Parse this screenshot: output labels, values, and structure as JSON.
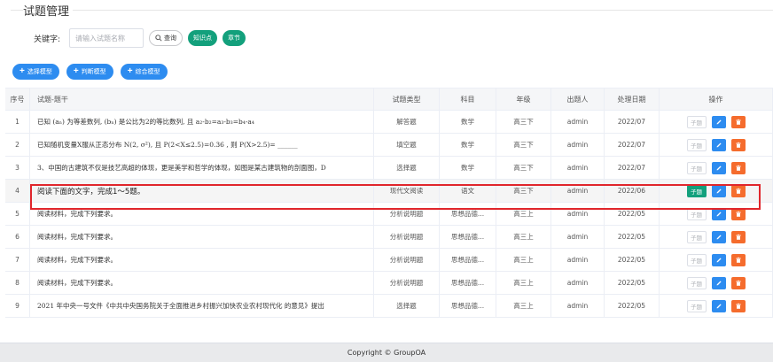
{
  "page": {
    "title": "试题管理"
  },
  "search": {
    "label": "关键字:",
    "placeholder": "请输入试题名称",
    "query_label": "查询",
    "knowledge_label": "知识点",
    "chapter_label": "章节"
  },
  "toolbar": {
    "buttons": [
      {
        "label": "选择模型"
      },
      {
        "label": "判断模型"
      },
      {
        "label": "综合模型"
      }
    ]
  },
  "table": {
    "columns": [
      "序号",
      "试题-题干",
      "试题类型",
      "科目",
      "年级",
      "出题人",
      "处理日期",
      "操作"
    ],
    "rows": [
      {
        "no": "1",
        "stem": "已知 (aₙ) 为等差数列, (bₙ) 是公比为2的等比数列, 且 a₂-b₂=a₃-b₃=b₄-a₄",
        "type": "解答题",
        "subject": "数学",
        "grade": "高三下",
        "author": "admin",
        "date": "2022/07",
        "sub": "子题"
      },
      {
        "no": "2",
        "stem": "已知随机变量X服从正态分布 N(2, σ²), 且 P(2<X≤2.5)=0.36 , 则 P(X>2.5)= ______",
        "type": "填空题",
        "subject": "数学",
        "grade": "高三下",
        "author": "admin",
        "date": "2022/07",
        "sub": "子题"
      },
      {
        "no": "3",
        "stem": "3、中国的古建筑不仅是技艺高超的体现，更是美学和哲学的体现，如图是某古建筑物的剖面图，D",
        "type": "选择题",
        "subject": "数学",
        "grade": "高三下",
        "author": "admin",
        "date": "2022/07",
        "sub": "子题"
      },
      {
        "no": "4",
        "stem": "阅读下面的文字，完成1～5题。",
        "type": "现代文阅读",
        "subject": "语文",
        "grade": "高三下",
        "author": "admin",
        "date": "2022/06",
        "sub": "子题"
      },
      {
        "no": "5",
        "stem": "阅读材料，完成下列要求。",
        "type": "分析说明题",
        "subject": "思想品德...",
        "grade": "高三上",
        "author": "admin",
        "date": "2022/05",
        "sub": "子题"
      },
      {
        "no": "6",
        "stem": "阅读材料，完成下列要求。",
        "type": "分析说明题",
        "subject": "思想品德...",
        "grade": "高三上",
        "author": "admin",
        "date": "2022/05",
        "sub": "子题"
      },
      {
        "no": "7",
        "stem": "阅读材料，完成下列要求。",
        "type": "分析说明题",
        "subject": "思想品德...",
        "grade": "高三上",
        "author": "admin",
        "date": "2022/05",
        "sub": "子题"
      },
      {
        "no": "8",
        "stem": "阅读材料，完成下列要求。",
        "type": "分析说明题",
        "subject": "思想品德...",
        "grade": "高三上",
        "author": "admin",
        "date": "2022/05",
        "sub": "子题"
      },
      {
        "no": "9",
        "stem": "2021 年中央一号文件《中共中央国务院关于全面推进乡村振兴加快农业农村现代化 的意见》提出",
        "type": "选择题",
        "subject": "思想品德...",
        "grade": "高三上",
        "author": "admin",
        "date": "2022/05",
        "sub": "子题"
      }
    ]
  },
  "footer": {
    "text": "Copyright © GroupOA"
  },
  "colors": {
    "primary": "#2d8cf0",
    "success": "#13a07c",
    "danger": "#f56c2d",
    "highlight_border": "#e0262c"
  }
}
